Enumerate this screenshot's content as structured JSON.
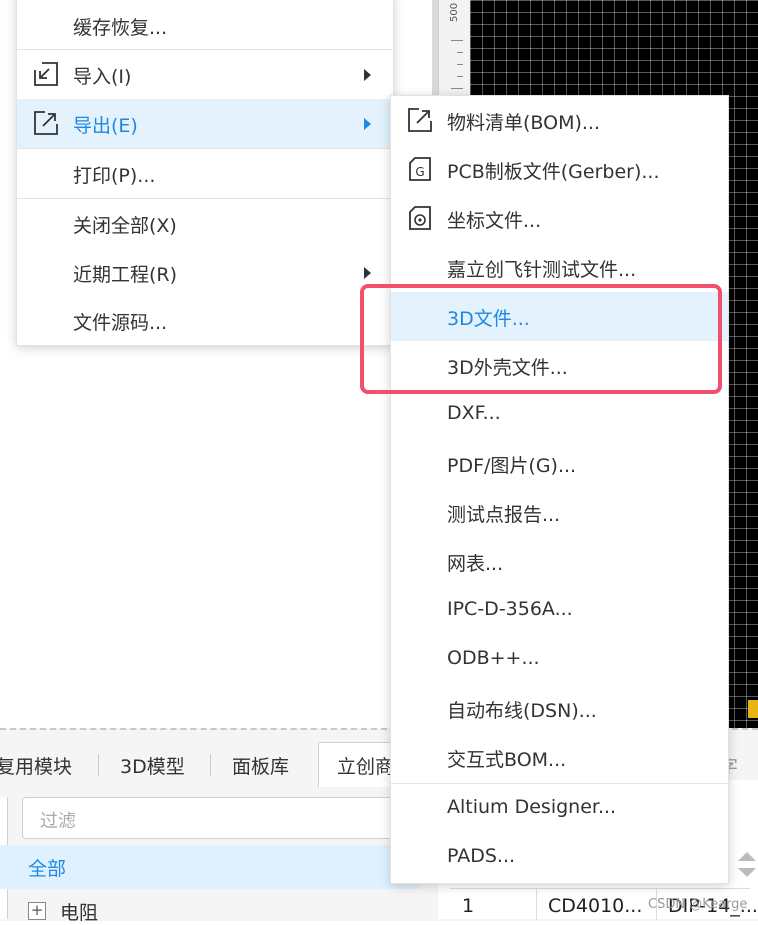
{
  "ruler": {
    "label": "500"
  },
  "file_menu": {
    "items": [
      {
        "label": "缓存恢复..."
      },
      {
        "label": "导入(I)"
      },
      {
        "label": "导出(E)"
      },
      {
        "label": "打印(P)..."
      },
      {
        "label": "关闭全部(X)"
      },
      {
        "label": "近期工程(R)"
      },
      {
        "label": "文件源码..."
      }
    ]
  },
  "export_menu": {
    "items": [
      {
        "label": "物料清单(BOM)..."
      },
      {
        "label": "PCB制板文件(Gerber)..."
      },
      {
        "label": "坐标文件..."
      },
      {
        "label": "嘉立创飞针测试文件..."
      },
      {
        "label": "3D文件..."
      },
      {
        "label": "3D外壳文件..."
      },
      {
        "label": "DXF..."
      },
      {
        "label": "PDF/图片(G)..."
      },
      {
        "label": "测试点报告..."
      },
      {
        "label": "网表..."
      },
      {
        "label": "IPC-D-356A..."
      },
      {
        "label": "ODB++..."
      },
      {
        "label": "自动布线(DSN)..."
      },
      {
        "label": "交互式BOM..."
      },
      {
        "label": "Altium Designer..."
      },
      {
        "label": "PADS..."
      }
    ]
  },
  "bottom_tabs": [
    "复用模块",
    "3D模型",
    "面板库",
    "立创商"
  ],
  "filter": {
    "placeholder": "过滤"
  },
  "tree": {
    "all_label": "全部",
    "first_item": "电阻"
  },
  "right_panel": {
    "hint": "个字",
    "row": {
      "index": "1",
      "name": "CD4010...",
      "package": "DIP-14_..."
    }
  },
  "watermark": "CSDN @Kearge",
  "colors": {
    "accent": "#1e88e5",
    "highlight_bg": "#e3f2fd",
    "annotation_border": "#f0506e"
  }
}
